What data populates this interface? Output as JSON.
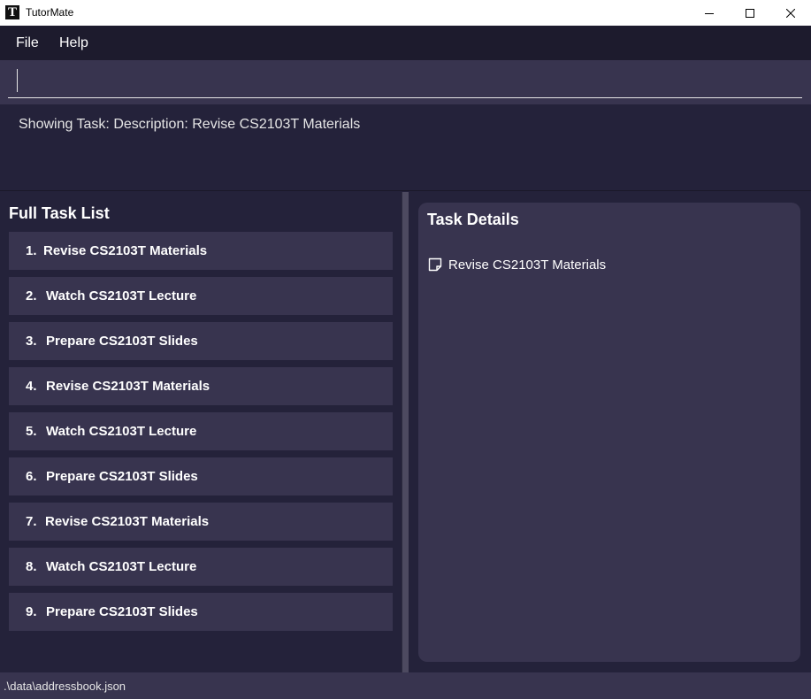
{
  "window": {
    "icon_letter": "T",
    "title": "TutorMate"
  },
  "menu": {
    "items": [
      {
        "label": "File"
      },
      {
        "label": "Help"
      }
    ]
  },
  "command": {
    "value": "",
    "placeholder": ""
  },
  "result": {
    "text": "Showing Task: Description: Revise CS2103T Materials"
  },
  "task_list": {
    "heading": "Full Task List",
    "items": [
      {
        "index": "1.",
        "name": "Revise CS2103T Materials"
      },
      {
        "index": "2.",
        "name": "Watch CS2103T Lecture"
      },
      {
        "index": "3.",
        "name": "Prepare CS2103T Slides"
      },
      {
        "index": "4.",
        "name": "Revise CS2103T Materials"
      },
      {
        "index": "5.",
        "name": "Watch CS2103T Lecture"
      },
      {
        "index": "6.",
        "name": "Prepare CS2103T Slides"
      },
      {
        "index": "7.",
        "name": "Revise CS2103T Materials"
      },
      {
        "index": "8.",
        "name": "Watch CS2103T Lecture"
      },
      {
        "index": "9.",
        "name": "Prepare CS2103T Slides"
      }
    ]
  },
  "task_details": {
    "heading": "Task Details",
    "icon": "note-icon",
    "task_name": "Revise CS2103T Materials"
  },
  "status": {
    "path": ".\\data\\addressbook.json"
  },
  "colors": {
    "background": "#24223a",
    "panel": "#38344f",
    "menubar": "#1d1b2d",
    "text": "#ffffff"
  }
}
